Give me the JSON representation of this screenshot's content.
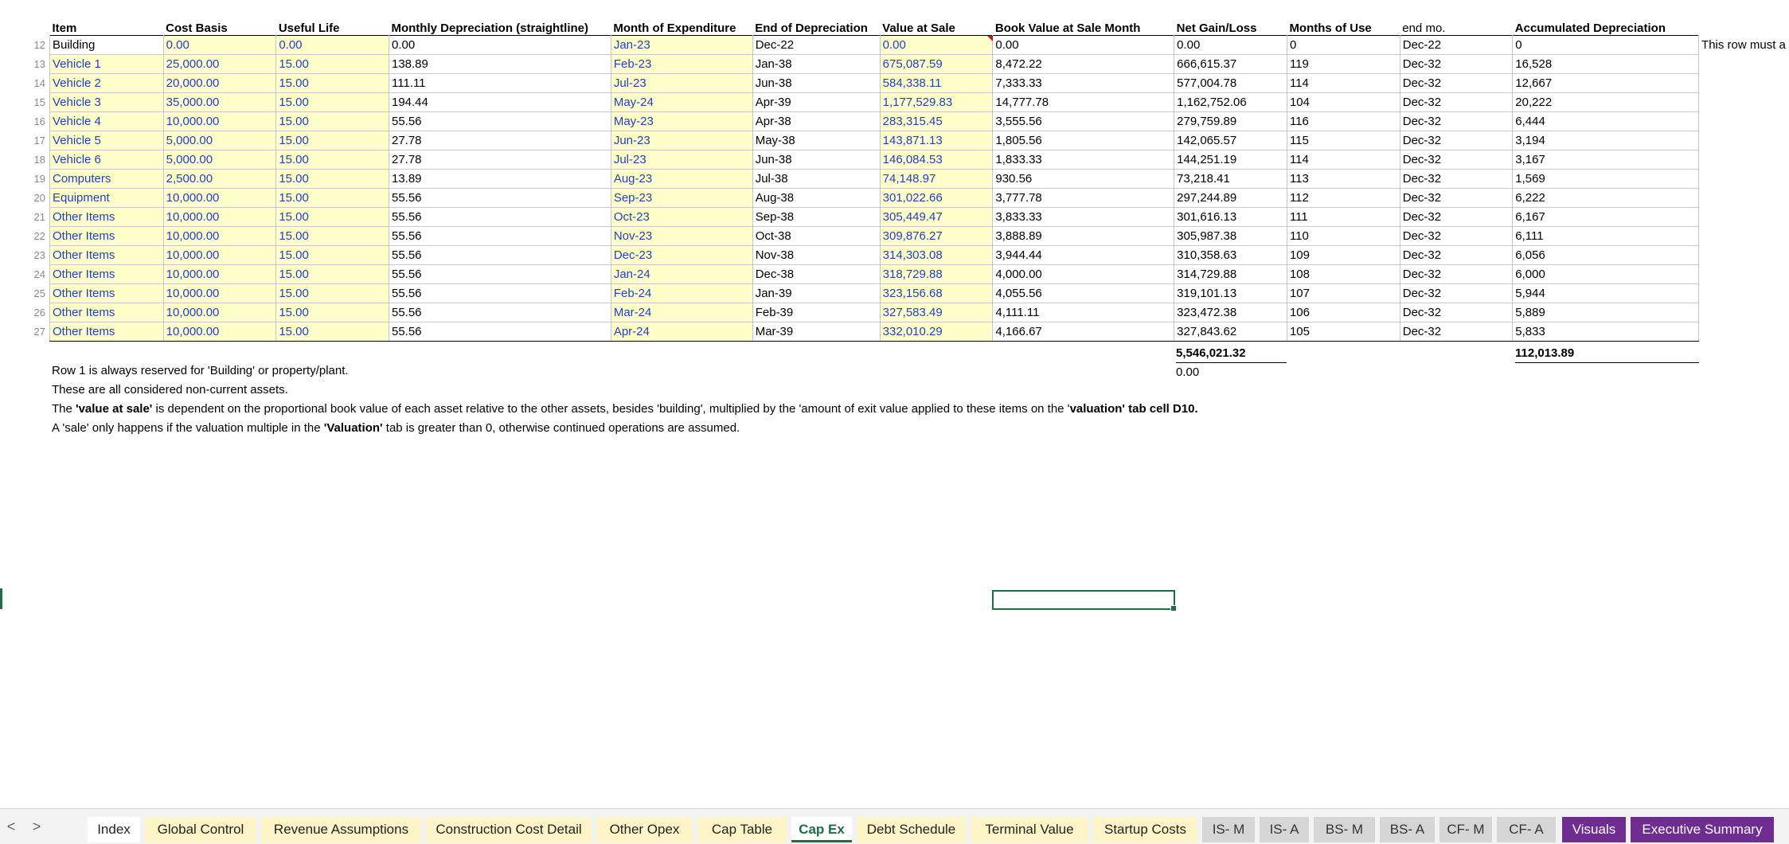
{
  "headers": [
    "Item",
    "Cost Basis",
    "Useful Life",
    "Monthly Depreciation (straightline)",
    "Month of Expenditure",
    "End of Depreciation",
    "Value at Sale",
    "Book Value at Sale Month",
    "Net Gain/Loss",
    "Months of Use",
    "end mo.",
    "Accumulated Depreciation"
  ],
  "row_note": "This row must a",
  "rows": [
    {
      "num": "12",
      "item": "Building",
      "cost": "0.00",
      "life": "0.00",
      "monthly": "0.00",
      "month": "Jan-23",
      "end": "Dec-22",
      "sale": "0.00",
      "book": "0.00",
      "gain": "0.00",
      "months": "0",
      "endmo": "Dec-22",
      "accum": "0"
    },
    {
      "num": "13",
      "item": "Vehicle 1",
      "cost": "25,000.00",
      "life": "15.00",
      "monthly": "138.89",
      "month": "Feb-23",
      "end": "Jan-38",
      "sale": "675,087.59",
      "book": "8,472.22",
      "gain": "666,615.37",
      "months": "119",
      "endmo": "Dec-32",
      "accum": "16,528"
    },
    {
      "num": "14",
      "item": "Vehicle 2",
      "cost": "20,000.00",
      "life": "15.00",
      "monthly": "111.11",
      "month": "Jul-23",
      "end": "Jun-38",
      "sale": "584,338.11",
      "book": "7,333.33",
      "gain": "577,004.78",
      "months": "114",
      "endmo": "Dec-32",
      "accum": "12,667"
    },
    {
      "num": "15",
      "item": "Vehicle 3",
      "cost": "35,000.00",
      "life": "15.00",
      "monthly": "194.44",
      "month": "May-24",
      "end": "Apr-39",
      "sale": "1,177,529.83",
      "book": "14,777.78",
      "gain": "1,162,752.06",
      "months": "104",
      "endmo": "Dec-32",
      "accum": "20,222"
    },
    {
      "num": "16",
      "item": "Vehicle 4",
      "cost": "10,000.00",
      "life": "15.00",
      "monthly": "55.56",
      "month": "May-23",
      "end": "Apr-38",
      "sale": "283,315.45",
      "book": "3,555.56",
      "gain": "279,759.89",
      "months": "116",
      "endmo": "Dec-32",
      "accum": "6,444"
    },
    {
      "num": "17",
      "item": "Vehicle 5",
      "cost": "5,000.00",
      "life": "15.00",
      "monthly": "27.78",
      "month": "Jun-23",
      "end": "May-38",
      "sale": "143,871.13",
      "book": "1,805.56",
      "gain": "142,065.57",
      "months": "115",
      "endmo": "Dec-32",
      "accum": "3,194"
    },
    {
      "num": "18",
      "item": "Vehicle 6",
      "cost": "5,000.00",
      "life": "15.00",
      "monthly": "27.78",
      "month": "Jul-23",
      "end": "Jun-38",
      "sale": "146,084.53",
      "book": "1,833.33",
      "gain": "144,251.19",
      "months": "114",
      "endmo": "Dec-32",
      "accum": "3,167"
    },
    {
      "num": "19",
      "item": "Computers",
      "cost": "2,500.00",
      "life": "15.00",
      "monthly": "13.89",
      "month": "Aug-23",
      "end": "Jul-38",
      "sale": "74,148.97",
      "book": "930.56",
      "gain": "73,218.41",
      "months": "113",
      "endmo": "Dec-32",
      "accum": "1,569"
    },
    {
      "num": "20",
      "item": "Equipment",
      "cost": "10,000.00",
      "life": "15.00",
      "monthly": "55.56",
      "month": "Sep-23",
      "end": "Aug-38",
      "sale": "301,022.66",
      "book": "3,777.78",
      "gain": "297,244.89",
      "months": "112",
      "endmo": "Dec-32",
      "accum": "6,222"
    },
    {
      "num": "21",
      "item": "Other Items",
      "cost": "10,000.00",
      "life": "15.00",
      "monthly": "55.56",
      "month": "Oct-23",
      "end": "Sep-38",
      "sale": "305,449.47",
      "book": "3,833.33",
      "gain": "301,616.13",
      "months": "111",
      "endmo": "Dec-32",
      "accum": "6,167"
    },
    {
      "num": "22",
      "item": "Other Items",
      "cost": "10,000.00",
      "life": "15.00",
      "monthly": "55.56",
      "month": "Nov-23",
      "end": "Oct-38",
      "sale": "309,876.27",
      "book": "3,888.89",
      "gain": "305,987.38",
      "months": "110",
      "endmo": "Dec-32",
      "accum": "6,111"
    },
    {
      "num": "23",
      "item": "Other Items",
      "cost": "10,000.00",
      "life": "15.00",
      "monthly": "55.56",
      "month": "Dec-23",
      "end": "Nov-38",
      "sale": "314,303.08",
      "book": "3,944.44",
      "gain": "310,358.63",
      "months": "109",
      "endmo": "Dec-32",
      "accum": "6,056"
    },
    {
      "num": "24",
      "item": "Other Items",
      "cost": "10,000.00",
      "life": "15.00",
      "monthly": "55.56",
      "month": "Jan-24",
      "end": "Dec-38",
      "sale": "318,729.88",
      "book": "4,000.00",
      "gain": "314,729.88",
      "months": "108",
      "endmo": "Dec-32",
      "accum": "6,000"
    },
    {
      "num": "25",
      "item": "Other Items",
      "cost": "10,000.00",
      "life": "15.00",
      "monthly": "55.56",
      "month": "Feb-24",
      "end": "Jan-39",
      "sale": "323,156.68",
      "book": "4,055.56",
      "gain": "319,101.13",
      "months": "107",
      "endmo": "Dec-32",
      "accum": "5,944"
    },
    {
      "num": "26",
      "item": "Other Items",
      "cost": "10,000.00",
      "life": "15.00",
      "monthly": "55.56",
      "month": "Mar-24",
      "end": "Feb-39",
      "sale": "327,583.49",
      "book": "4,111.11",
      "gain": "323,472.38",
      "months": "106",
      "endmo": "Dec-32",
      "accum": "5,889"
    },
    {
      "num": "27",
      "item": "Other Items",
      "cost": "10,000.00",
      "life": "15.00",
      "monthly": "55.56",
      "month": "Apr-24",
      "end": "Mar-39",
      "sale": "332,010.29",
      "book": "4,166.67",
      "gain": "327,843.62",
      "months": "105",
      "endmo": "Dec-32",
      "accum": "5,833"
    }
  ],
  "totals": {
    "gain_total": "5,546,021.32",
    "accum_total": "112,013.89",
    "gain_check": "0.00"
  },
  "notes": [
    {
      "text": "Row 1 is always reserved for 'Building' or property/plant."
    },
    {
      "text": "These are all considered non-current assets."
    },
    {
      "p1": "The ",
      "b1": "'value at sale'",
      "p2": " is dependent on the proportional book value of each asset relative to the other assets, besides 'building', multiplied by the 'amount of exit value applied to these items on the '",
      "b2": "valuation' tab cell D10.",
      "p3": ""
    },
    {
      "p1": "A 'sale' only happens if the valuation multiple in the ",
      "b1": "'Valuation'",
      "p2": " tab is greater than 0, otherwise continued operations are assumed."
    }
  ],
  "tabs": [
    "Index",
    "Global Control",
    "Revenue Assumptions",
    "Construction Cost Detail",
    "Other Opex",
    "Cap Table",
    "Cap Ex",
    "Debt Schedule",
    "Terminal Value",
    "Startup Costs",
    "IS- M",
    "IS- A",
    "BS- M",
    "BS- A",
    "CF- M",
    "CF- A",
    "Visuals",
    "Executive Summary"
  ],
  "active_tab": "Cap Ex",
  "nav": {
    "prev": "<",
    "next": ">"
  }
}
